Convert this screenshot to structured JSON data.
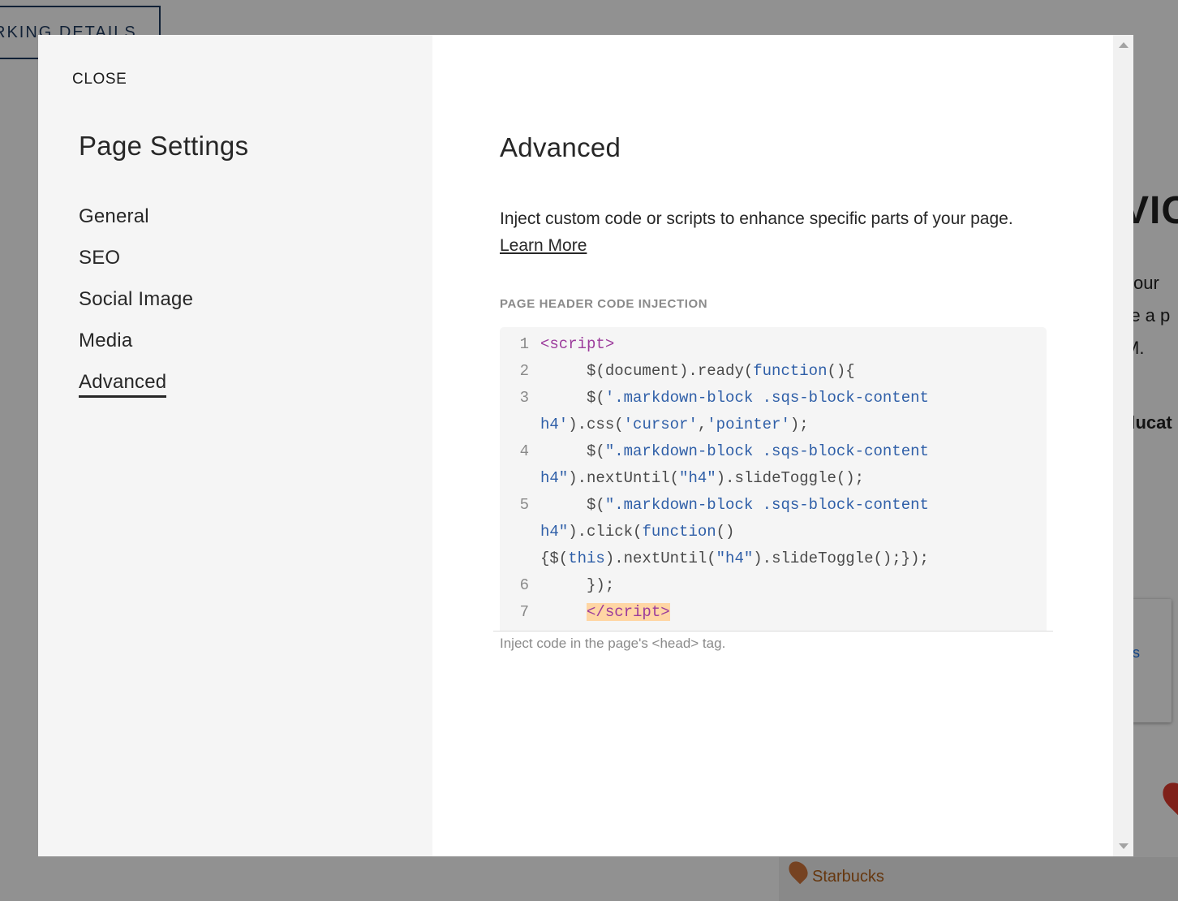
{
  "background": {
    "parking_button": "RKING DETAILS",
    "heading_fragment": "VIC",
    "text_lines": [
      "your",
      "re a p",
      "M."
    ],
    "bold_fragment": "ducat",
    "map_link": "ns",
    "map_place": "Starbucks"
  },
  "modal": {
    "close_label": "CLOSE",
    "sidebar": {
      "title": "Page Settings",
      "items": [
        {
          "label": "General",
          "active": false
        },
        {
          "label": "SEO",
          "active": false
        },
        {
          "label": "Social Image",
          "active": false
        },
        {
          "label": "Media",
          "active": false
        },
        {
          "label": "Advanced",
          "active": true
        }
      ]
    },
    "content": {
      "title": "Advanced",
      "description": "Inject custom code or scripts to enhance specific parts of your page.",
      "learn_more": "Learn More",
      "field_label": "PAGE HEADER CODE INJECTION",
      "hint": "Inject code in the page's <head> tag."
    }
  },
  "colors": {
    "sidebar_bg": "#f5f5f5",
    "text": "#272727",
    "code_tag": "#9c3c9c",
    "code_string": "#2f5fa8",
    "code_highlight": "#ffd6a4"
  }
}
